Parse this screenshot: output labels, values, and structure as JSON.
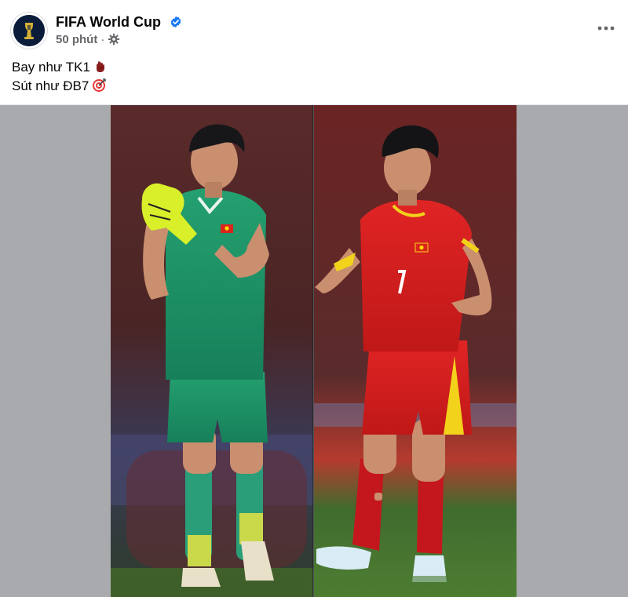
{
  "post": {
    "page_name": "FIFA World Cup",
    "time": "50 phút",
    "separator": "·",
    "caption_lines": [
      {
        "text": "Bay như TK1",
        "emoji": "glove-emoji"
      },
      {
        "text": "Sút như ĐB7",
        "emoji": "target-emoji"
      }
    ],
    "avatar_icon": "fifa-trophy-logo-icon",
    "verified_icon": "verified-badge-icon",
    "audience_icon": "gear-icon",
    "more_icon": "more-options-icon"
  },
  "photo": {
    "left_player_number": "",
    "right_player_number": "7"
  },
  "colors": {
    "text_primary": "#050505",
    "text_secondary": "#65676b",
    "verified_blue": "#1877f2",
    "media_background": "#a9aaae",
    "gk_kit_green": "#1f9a6a",
    "outfield_kit_red": "#d81f1f",
    "kit_trim_yellow": "#f2d21b"
  }
}
